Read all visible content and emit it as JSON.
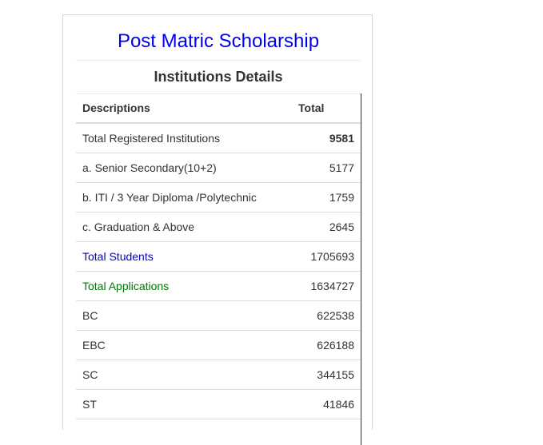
{
  "header": {
    "title": "Post Matric Scholarship",
    "subtitle": "Institutions Details"
  },
  "table": {
    "columns": [
      "Descriptions",
      "Total"
    ],
    "rows": [
      {
        "label": "Total Registered Institutions",
        "value": "9581"
      },
      {
        "label": "a. Senior Secondary(10+2)",
        "value": "5177"
      },
      {
        "label": "b. ITI / 3 Year Diploma /Polytechnic",
        "value": "1759"
      },
      {
        "label": "c. Graduation & Above",
        "value": "2645"
      },
      {
        "label": "Total Students",
        "value": "1705693"
      },
      {
        "label": "Total Applications",
        "value": "1634727"
      },
      {
        "label": "BC",
        "value": "622538"
      },
      {
        "label": "EBC",
        "value": "626188"
      },
      {
        "label": "SC",
        "value": "344155"
      },
      {
        "label": "ST",
        "value": "41846"
      }
    ]
  },
  "colors": {
    "title": "#0000ee",
    "students_label": "#0000cc",
    "applications_label": "#007a00"
  }
}
